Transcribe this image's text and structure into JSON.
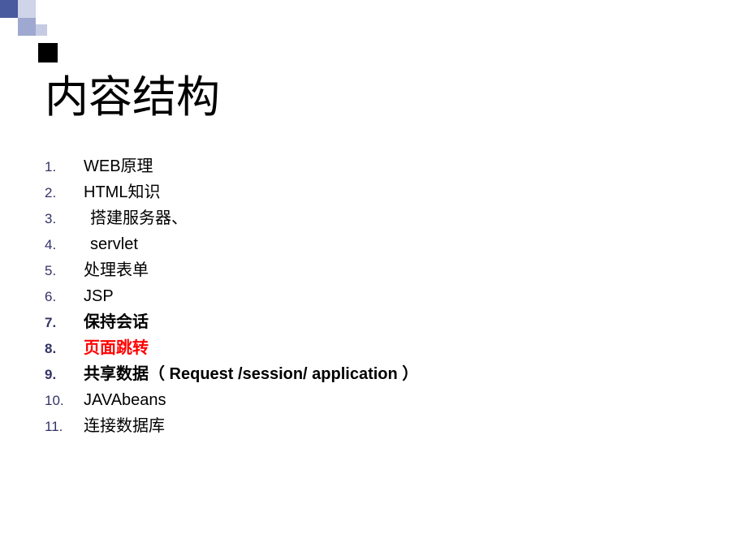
{
  "title": "内容结构",
  "items": [
    {
      "num": "1.",
      "text": "WEB原理",
      "bold": false,
      "red": false,
      "indent": false
    },
    {
      "num": "2.",
      "text": "HTML知识",
      "bold": false,
      "red": false,
      "indent": false
    },
    {
      "num": "3.",
      "text": "搭建服务器、",
      "bold": false,
      "red": false,
      "indent": true
    },
    {
      "num": "4.",
      "text": "servlet",
      "bold": false,
      "red": false,
      "indent": true
    },
    {
      "num": "5.",
      "text": "处理表单",
      "bold": false,
      "red": false,
      "indent": false
    },
    {
      "num": "6.",
      "text": "JSP",
      "bold": false,
      "red": false,
      "indent": false
    },
    {
      "num": "7.",
      "text": "保持会话",
      "bold": true,
      "red": false,
      "indent": false
    },
    {
      "num": "8.",
      "text": "页面跳转",
      "bold": true,
      "red": true,
      "indent": false
    },
    {
      "num": "9.",
      "text": "共享数据（ Request /session/  application ）",
      "bold": true,
      "red": false,
      "indent": false
    },
    {
      "num": "10.",
      "text": "JAVAbeans",
      "bold": false,
      "red": false,
      "indent": false
    },
    {
      "num": "11.",
      "text": "连接数据库",
      "bold": false,
      "red": false,
      "indent": false
    }
  ]
}
